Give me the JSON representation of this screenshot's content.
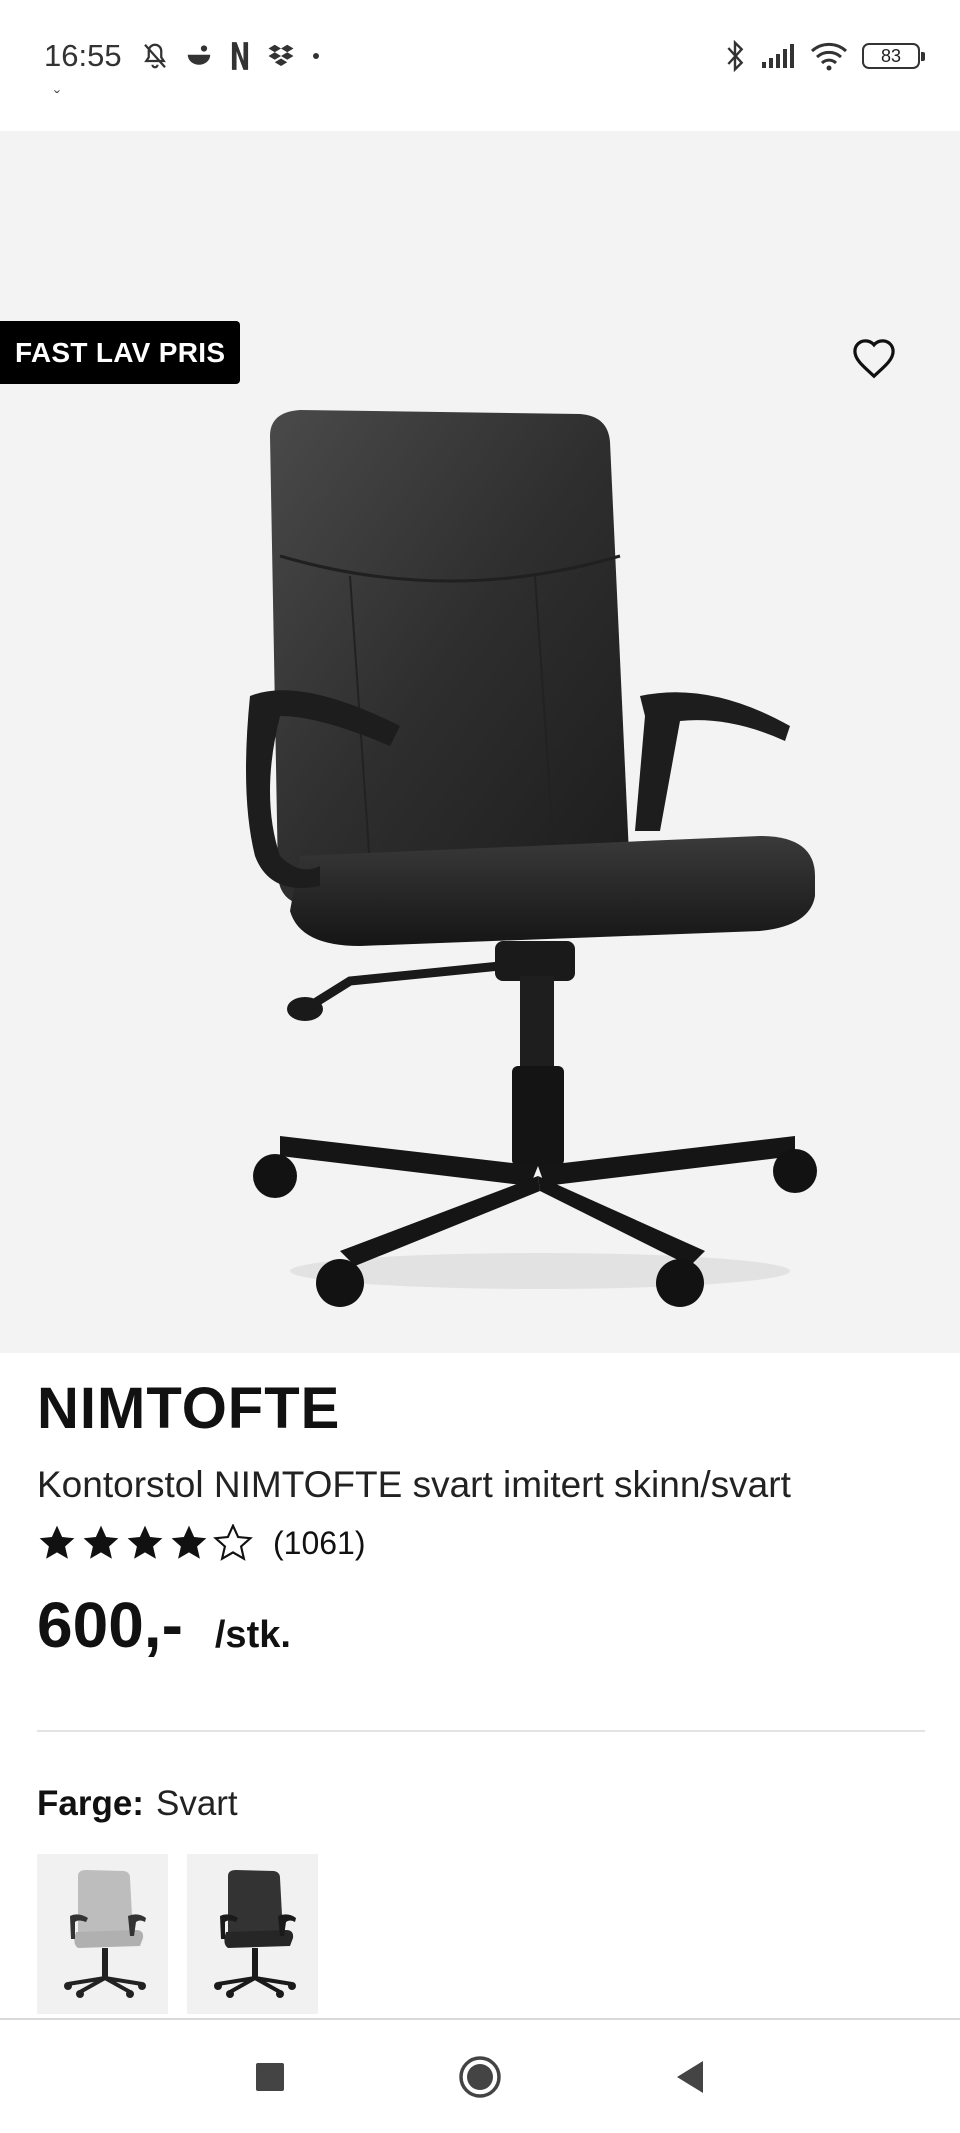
{
  "status_bar": {
    "time": "16:55",
    "battery": "83",
    "icons": [
      "notifications-off-icon",
      "app-icon",
      "netflix-icon",
      "dropbox-icon",
      "dot-icon",
      "bluetooth-icon",
      "signal-icon",
      "wifi-icon",
      "battery-icon"
    ]
  },
  "gallery": {
    "badge": "FAST LAV PRIS",
    "favorite_icon": "heart-icon",
    "image_alt": "Kontorstol NIMTOFTE svart",
    "dot_count": 4,
    "active_dot": 1
  },
  "product": {
    "brand": "NIMTOFTE",
    "title": "Kontorstol NIMTOFTE svart imitert skinn/svart",
    "rating": 4,
    "rating_max": 5,
    "rating_count": "(1061)",
    "price": "600,-",
    "unit": "/stk."
  },
  "variant": {
    "label": "Farge:",
    "value": "Svart",
    "swatches": [
      {
        "name": "Grå",
        "color": "#bdbdbd"
      },
      {
        "name": "Svart",
        "color": "#2b2b2b"
      }
    ]
  },
  "nav": {
    "recent": "recent-apps-icon",
    "home": "home-icon",
    "back": "back-icon"
  }
}
